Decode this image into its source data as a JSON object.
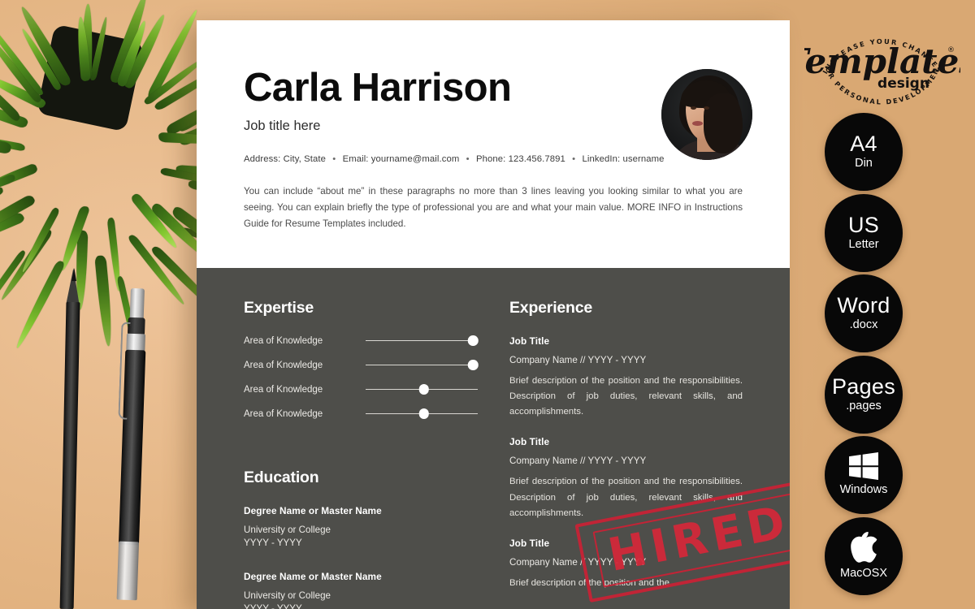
{
  "theme": {
    "background": "#e7bb8a",
    "paper": "#ffffff",
    "panel_dark": "#4e4e4a",
    "badge": "#080808",
    "stamp_red": "#d3283a"
  },
  "resume": {
    "name": "Carla Harrison",
    "job_title": "Job title here",
    "contact": {
      "address": "Address: City, State",
      "email": "Email: yourname@mail.com",
      "phone": "Phone: 123.456.7891",
      "linkedin": "LinkedIn: username",
      "separator": "•"
    },
    "about": "You can include “about me” in these paragraphs no more than 3 lines leaving you looking similar to what you are seeing. You can explain briefly the type of professional you are and what your main value. MORE INFO in Instructions Guide for Resume Templates included.",
    "expertise": {
      "heading": "Expertise",
      "skills": [
        {
          "label": "Area of Knowledge",
          "level": 96
        },
        {
          "label": "Area of Knowledge",
          "level": 96
        },
        {
          "label": "Area of Knowledge",
          "level": 52
        },
        {
          "label": "Area of Knowledge",
          "level": 52
        }
      ]
    },
    "education": {
      "heading": "Education",
      "entries": [
        {
          "degree": "Degree Name or Master Name",
          "school": "University or College",
          "years": "YYYY - YYYY"
        },
        {
          "degree": "Degree Name or Master Name",
          "school": "University or College",
          "years": "YYYY - YYYY"
        }
      ]
    },
    "experience": {
      "heading": "Experience",
      "entries": [
        {
          "title": "Job Title",
          "company": "Company Name // YYYY - YYYY",
          "description": "Brief description of the position and the responsibilities. Description of job duties, relevant skills, and accomplishments."
        },
        {
          "title": "Job Title",
          "company": "Company Name // YYYY - YYYY",
          "description": "Brief description of the position and the responsibilities. Description of job duties, relevant skills, and accomplishments."
        },
        {
          "title": "Job Title",
          "company": "Company Name // YYYY - YYYY",
          "description": "Brief description of the position and the"
        }
      ]
    }
  },
  "stamp": {
    "text": "HIRED"
  },
  "rail": {
    "logo": {
      "brand": "Templates",
      "sub": "design",
      "arc_top": "INCREASE YOUR CHANCES",
      "arc_bottom": "FOR PERSONAL DEVELOPMENT",
      "trademark": "®"
    },
    "badges": [
      {
        "line1": "A4",
        "line2": "Din",
        "icon": ""
      },
      {
        "line1": "US",
        "line2": "Letter",
        "icon": ""
      },
      {
        "line1": "Word",
        "line2": ".docx",
        "icon": ""
      },
      {
        "line1": "Pages",
        "line2": ".pages",
        "icon": ""
      },
      {
        "line1": "",
        "line2": "Windows",
        "icon": "windows-logo-icon"
      },
      {
        "line1": "",
        "line2": "MacOSX",
        "icon": "apple-logo-icon"
      }
    ]
  }
}
